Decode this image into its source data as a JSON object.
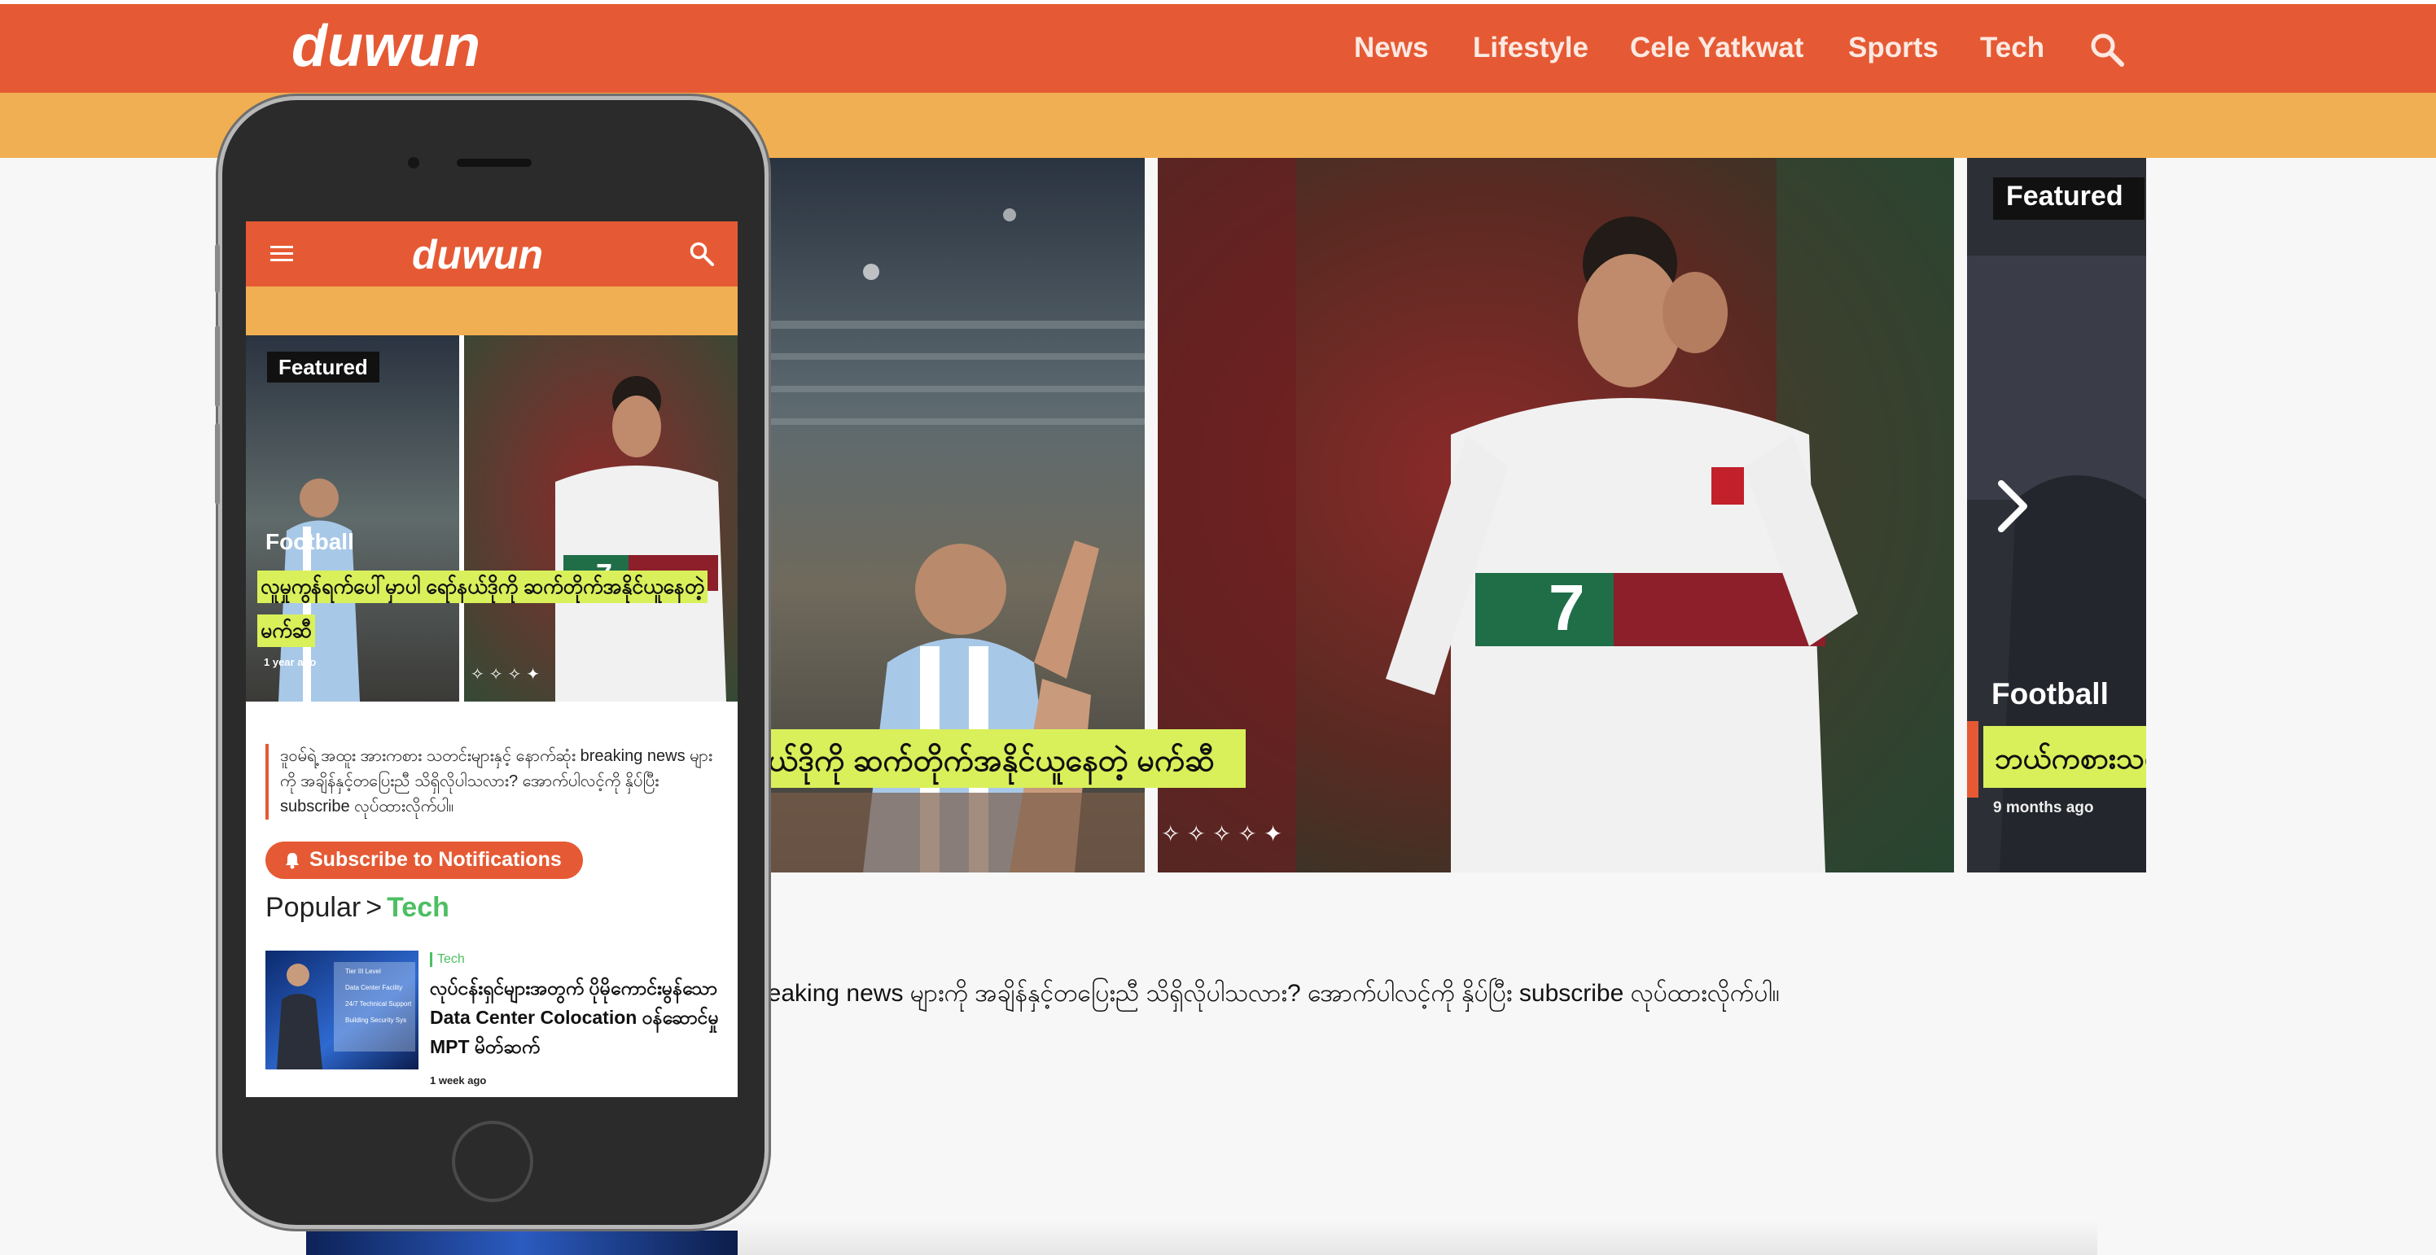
{
  "site": {
    "logo_text": "duwun",
    "nav": [
      "News",
      "Lifestyle",
      "Cele Yatkwat",
      "Sports",
      "Tech"
    ]
  },
  "colors": {
    "brand_orange": "#e55a34",
    "accent_yellow": "#f0af52",
    "highlight_lime": "#d9f05a",
    "tech_green": "#4cbf63"
  },
  "desktop": {
    "slider_badge": "Featured",
    "slide_category": "Football",
    "slide_headline_main": "ဂိုနယ်ဒိုကို ဆက်တိုက်အနိုင်ယူနေတဲ့ မက်ဆီ",
    "slide_headline_next": "ဘယ်ကစားသမား",
    "slide_time_next": "9 months ago",
    "subscribe_text": "breaking news များကို အချိန်နှင့်တပြေးညီ သိရှိလိုပါသလား? အောက်ပါလင့်ကို နှိပ်ပြီး subscribe လုပ်ထားလိုက်ပါ။"
  },
  "mobile": {
    "badge": "Featured",
    "category": "Football",
    "headline": "လူမှုကွန်ရက်ပေါ်မှာပါ ရော်နယ်ဒိုကို ဆက်တိုက်အနိုင်ယူနေတဲ့ မက်ဆီ",
    "time": "1 year ago",
    "description": "ဒူဝမ်ရဲ့ အထူး အားကစား သတင်းများနှင့် နောက်ဆုံး breaking news များကို အချိန်နှင့်တပြေးညီ သိရှိလိုပါသလား? အောက်ပါလင့်ကို နှိပ်ပြီး subscribe လုပ်ထားလိုက်ပါ။",
    "subscribe_button": "Subscribe to Notifications",
    "popular_prefix": "Popular",
    "popular_sep": ">",
    "popular_category": "Tech",
    "article": {
      "tag": "Tech",
      "title": "လုပ်ငန်းရှင်များအတွက် ပိုမိုကောင်းမွန်သော Data Center Colocation ဝန်ဆောင်မှု MPT မိတ်ဆက်",
      "time": "1 week ago",
      "thumb_lines": [
        "Tier III Level",
        "Data Center Facility",
        "24/7 Technical Support",
        "Building Security Sys"
      ]
    }
  },
  "icons": {
    "search": "search-icon",
    "menu": "hamburger-menu-icon",
    "next": "chevron-right-icon",
    "bell": "bell-icon"
  }
}
